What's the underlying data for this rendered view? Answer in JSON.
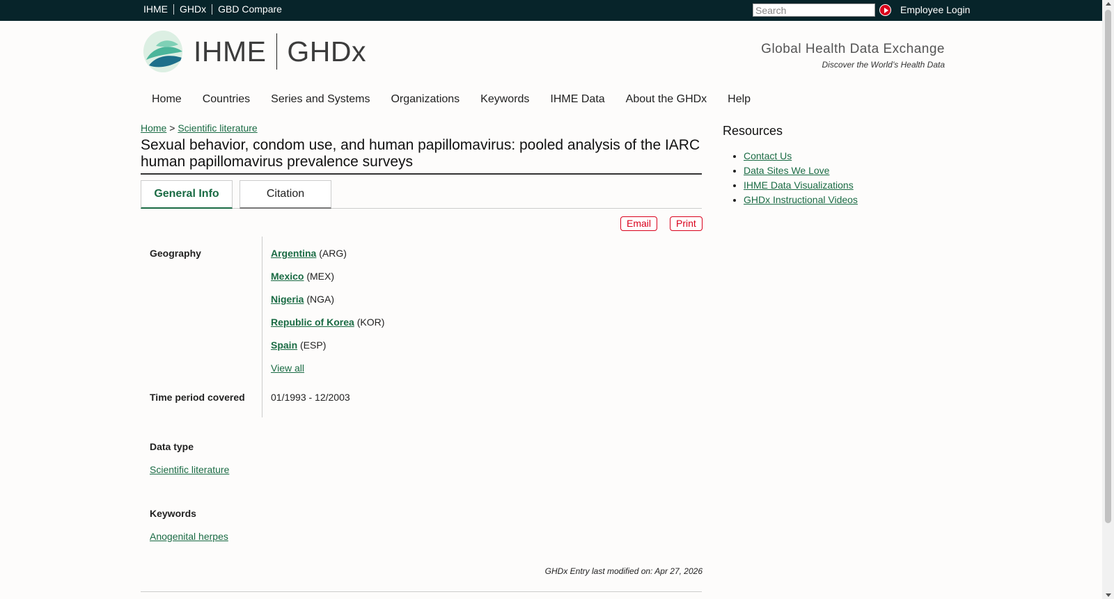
{
  "topbar": {
    "links": [
      "IHME",
      "GHDx",
      "GBD Compare"
    ],
    "search_placeholder": "Search",
    "login_label": "Employee Login"
  },
  "header": {
    "logo_left": "IHME",
    "logo_right": "GHDx",
    "tagline_title": "Global Health Data Exchange",
    "tagline_sub": "Discover the World’s Health Data"
  },
  "nav": [
    "Home",
    "Countries",
    "Series and Systems",
    "Organizations",
    "Keywords",
    "IHME Data",
    "About the GHDx",
    "Help"
  ],
  "breadcrumb": {
    "home": "Home",
    "sep": ">",
    "current": "Scientific literature"
  },
  "title": "Sexual behavior, condom use, and human papillomavirus: pooled analysis of the IARC human papillomavirus prevalence surveys",
  "tabs": {
    "active": "General Info",
    "inactive": "Citation"
  },
  "actions": {
    "email": "Email",
    "print": "Print"
  },
  "geography": {
    "label": "Geography",
    "items": [
      {
        "name": "Argentina",
        "code": "(ARG)"
      },
      {
        "name": "Mexico",
        "code": "(MEX)"
      },
      {
        "name": "Nigeria",
        "code": "(NGA)"
      },
      {
        "name": "Republic of Korea",
        "code": "(KOR)"
      },
      {
        "name": "Spain",
        "code": "(ESP)"
      }
    ],
    "view_all": "View all"
  },
  "time_period": {
    "label": "Time period covered",
    "value": "01/1993 - 12/2003"
  },
  "data_type": {
    "label": "Data type",
    "value": "Scientific literature"
  },
  "keywords": {
    "label": "Keywords",
    "value": "Anogenital herpes"
  },
  "modified": "GHDx Entry last modified on: Apr 27, 2026",
  "resources": {
    "title": "Resources",
    "items": [
      "Contact Us",
      "Data Sites We Love",
      "IHME Data Visualizations",
      "GHDx Instructional Videos"
    ]
  },
  "colors": {
    "topbar": "#07242a",
    "link": "#1a6b44",
    "accent_red": "#d9001b"
  }
}
